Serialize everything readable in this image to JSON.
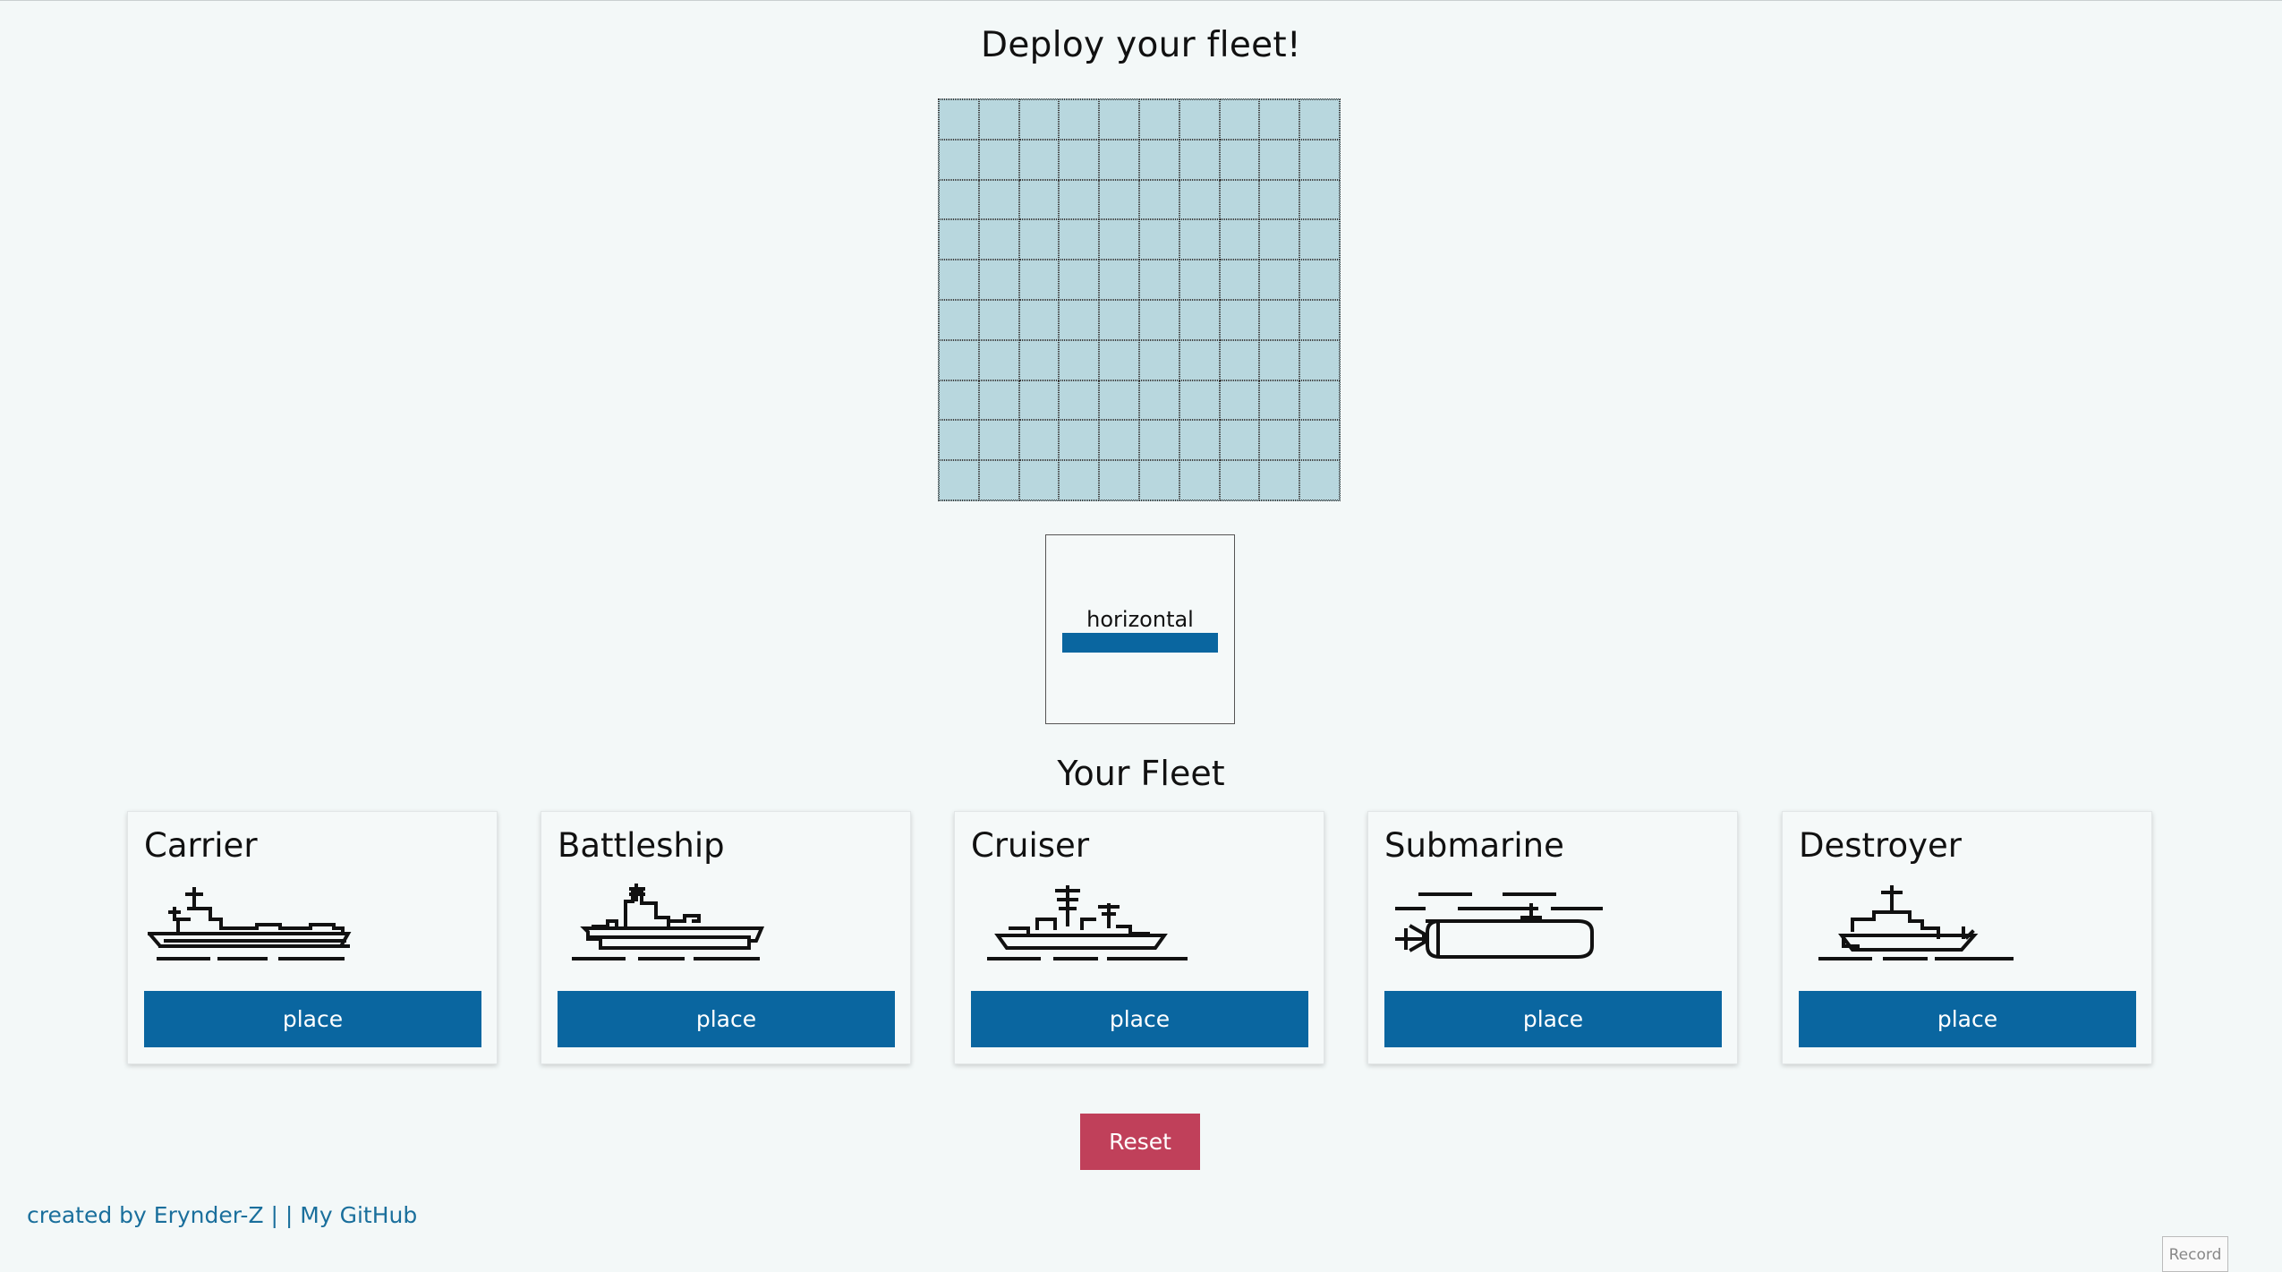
{
  "title": "Deploy your fleet!",
  "board": {
    "rows": 10,
    "cols": 10
  },
  "orientation": {
    "label": "horizontal",
    "accent": "#0a66a0"
  },
  "fleet": {
    "title": "Your Fleet",
    "ships": [
      {
        "name": "Carrier",
        "icon": "carrier-icon",
        "button": "place"
      },
      {
        "name": "Battleship",
        "icon": "battleship-icon",
        "button": "place"
      },
      {
        "name": "Cruiser",
        "icon": "cruiser-icon",
        "button": "place"
      },
      {
        "name": "Submarine",
        "icon": "submarine-icon",
        "button": "place"
      },
      {
        "name": "Destroyer",
        "icon": "destroyer-icon",
        "button": "place"
      }
    ]
  },
  "reset": {
    "label": "Reset",
    "color": "#c0405a"
  },
  "footer": {
    "created": "created by Erynder-Z",
    "separator": "| |",
    "github": "My GitHub"
  },
  "record": "Record",
  "colors": {
    "primary": "#0a66a0",
    "board": "#b8d7de",
    "background": "#f3f8f8"
  }
}
